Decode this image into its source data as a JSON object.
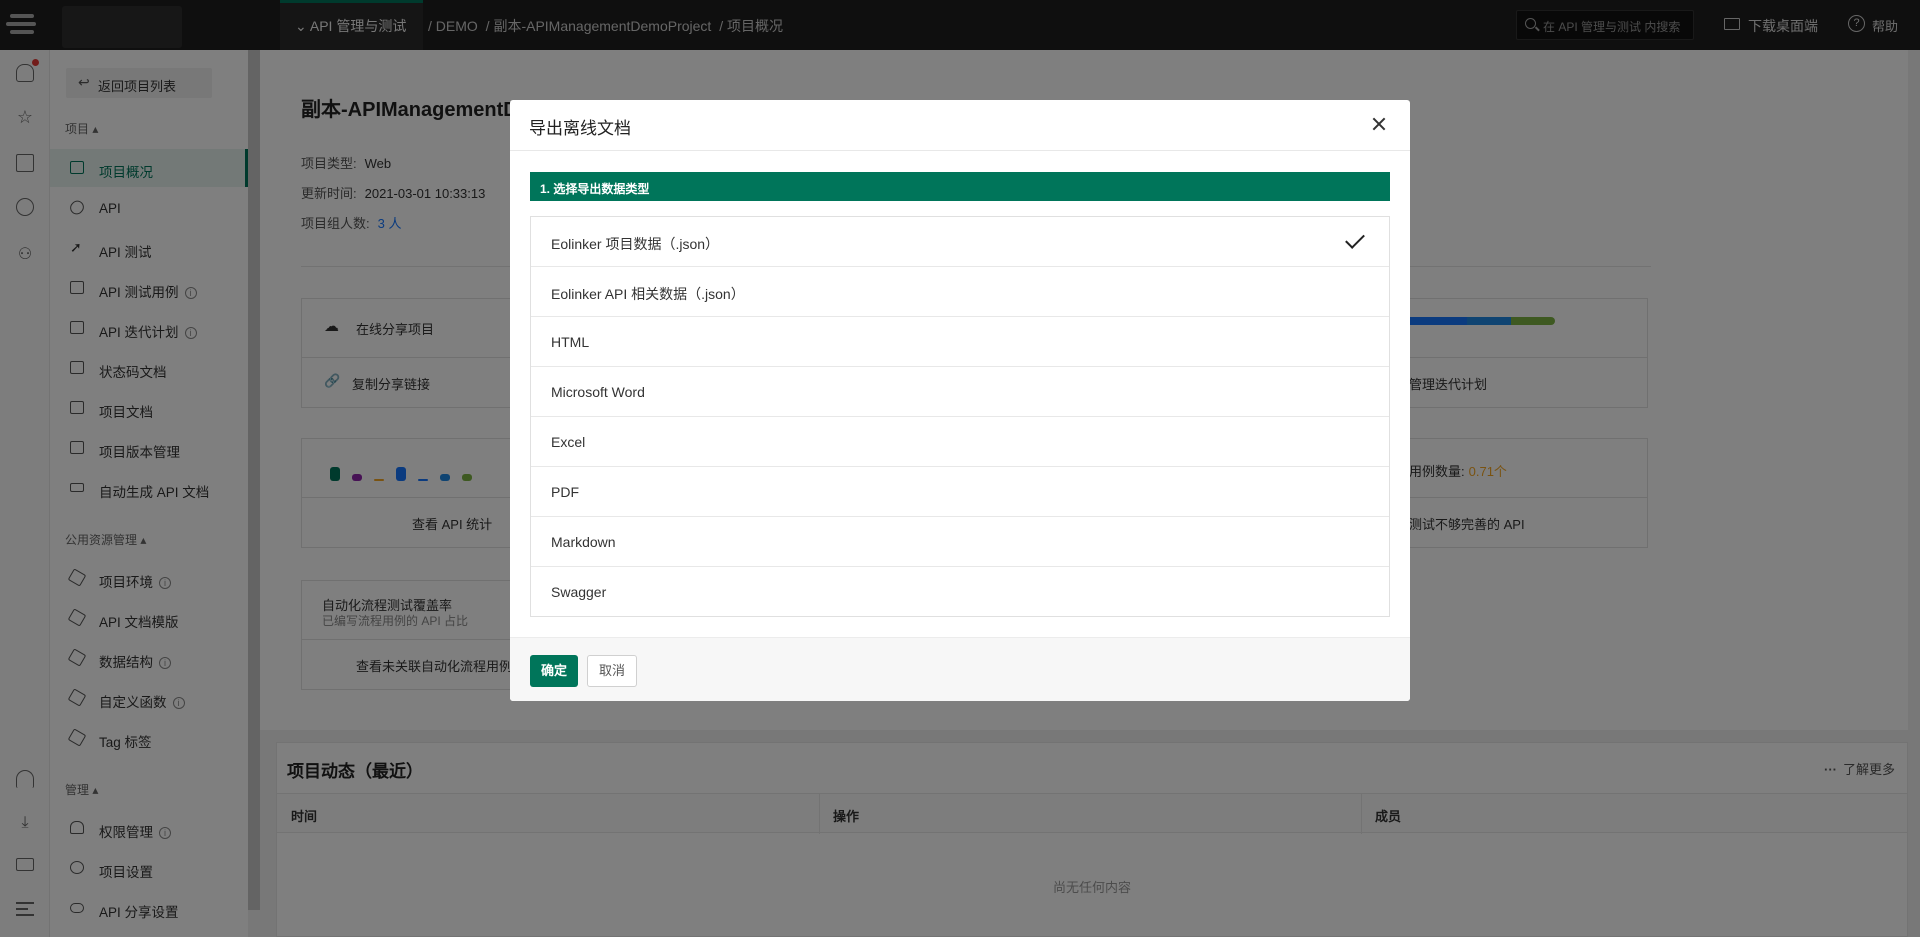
{
  "topbar": {
    "module": "API 管理与测试",
    "breadcrumb": [
      "/ DEMO",
      "/ 副本-APIManagementDemoProject",
      "/ 项目概况"
    ],
    "search_placeholder": "在 API 管理与测试 内搜索",
    "download": "下载桌面端",
    "help": "帮助"
  },
  "sidebar": {
    "back": "返回项目列表",
    "group_project": "项目 ▴",
    "group_public": "公用资源管理 ▴",
    "group_manage": "管理 ▴",
    "items_project": [
      {
        "label": "项目概况"
      },
      {
        "label": "API"
      },
      {
        "label": "API 测试"
      },
      {
        "label": "API 测试用例"
      },
      {
        "label": "API 迭代计划"
      },
      {
        "label": "状态码文档"
      },
      {
        "label": "项目文档"
      },
      {
        "label": "项目版本管理"
      },
      {
        "label": "自动生成 API 文档"
      }
    ],
    "items_public": [
      {
        "label": "项目环境"
      },
      {
        "label": "API 文档模版"
      },
      {
        "label": "数据结构"
      },
      {
        "label": "自定义函数"
      },
      {
        "label": "Tag 标签"
      }
    ],
    "items_manage": [
      {
        "label": "权限管理"
      },
      {
        "label": "项目设置"
      },
      {
        "label": "API 分享设置"
      }
    ]
  },
  "project": {
    "title": "副本-APIManagementDemoProject",
    "type_label": "项目类型:",
    "type_value": "Web",
    "updated_label": "更新时间:",
    "updated_value": "2021-03-01 10:33:13",
    "members_label": "项目组人数:",
    "members_value": "3 人"
  },
  "cards": {
    "share_online": "在线分享项目",
    "copy_link": "复制分享链接",
    "manage_iteration": "管理迭代计划",
    "view_api_stats": "查看 API 统计",
    "case_count_label": "用例数量:",
    "case_count_value": "0.71个",
    "incomplete_tests": "测试不够完善的 API",
    "auto_flow_title": "自动化流程测试覆盖率",
    "auto_flow_sub": "已编写流程用例的 API 占比",
    "auto_flow_link": "查看未关联自动化流程用例"
  },
  "activity": {
    "title": "项目动态（最近）",
    "more": "了解更多",
    "columns": [
      "时间",
      "操作",
      "成员"
    ],
    "empty": "尚无任何内容"
  },
  "modal": {
    "title": "导出离线文档",
    "step": "1. 选择导出数据类型",
    "options": [
      {
        "label": "Eolinker 项目数据（.json）",
        "selected": true
      },
      {
        "label": "Eolinker API 相关数据（.json）",
        "selected": false
      },
      {
        "label": "HTML",
        "selected": false
      },
      {
        "label": "Microsoft Word",
        "selected": false
      },
      {
        "label": "Excel",
        "selected": false
      },
      {
        "label": "PDF",
        "selected": false
      },
      {
        "label": "Markdown",
        "selected": false
      },
      {
        "label": "Swagger",
        "selected": false
      }
    ],
    "confirm": "确定",
    "cancel": "取消"
  },
  "colors": {
    "brand": "#00755a",
    "link": "#1677ff",
    "warning": "#f5a623"
  }
}
